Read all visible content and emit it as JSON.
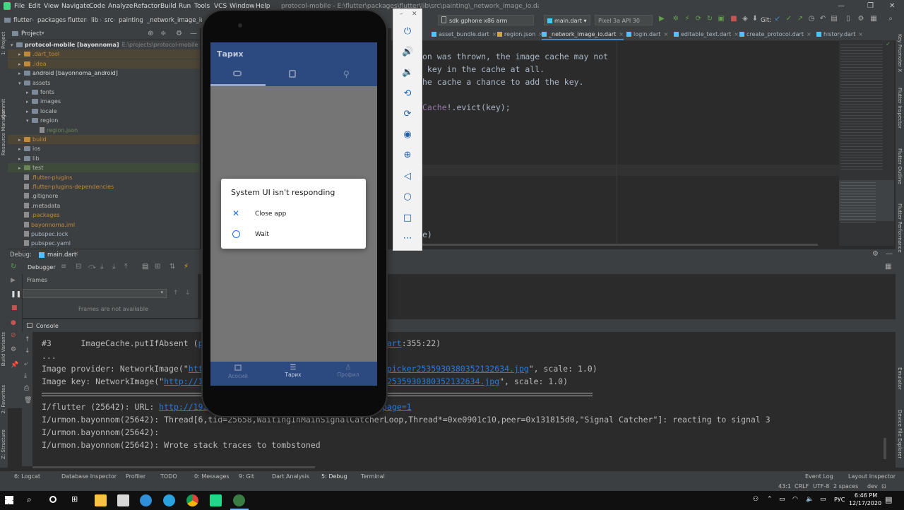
{
  "menubar": {
    "items": [
      "File",
      "Edit",
      "View",
      "Navigate",
      "Code",
      "Analyze",
      "Refactor",
      "Build",
      "Run",
      "Tools",
      "VCS",
      "Window",
      "Help"
    ],
    "title": "protocol-mobile - E:\\flutter\\packages\\flutter\\lib\\src\\painting\\_network_image_io.dart - Android Studio",
    "minimize": "—",
    "restore": "❐",
    "close": "✕"
  },
  "navbar": {
    "breadcrumbs": [
      "flutter",
      "packages",
      "flutter",
      "lib",
      "src",
      "painting",
      "_network_image_io"
    ],
    "device": "sdk gphone x86 arm (mobile)",
    "run_config": "main.dart",
    "avd": "Pixel 3a API 30",
    "git_label": "Git:"
  },
  "left_strip": [
    "1: Project",
    "Commit",
    "Resource Manager",
    "Build Variants",
    "2: Favorites",
    "Z: Structure"
  ],
  "right_strip": [
    "Key Promoter X",
    "Flutter Inspector",
    "Flutter Outline",
    "Flutter Performance",
    "Emulator",
    "Device File Explorer"
  ],
  "project": {
    "title": "Project",
    "tree": [
      {
        "label": "protocol-mobile [bayonnoma]",
        "suffix": "E:\\projects\\protocol-mobile",
        "indent": 0,
        "kind": "root",
        "open": true,
        "color": "#dcdcdc",
        "bg": ""
      },
      {
        "label": ".dart_tool",
        "indent": 1,
        "kind": "folder-orange",
        "open": false,
        "color": "#c08a3c",
        "bg": "#4d4536"
      },
      {
        "label": ".idea",
        "indent": 1,
        "kind": "folder-orange",
        "open": false,
        "color": "#c08a3c",
        "bg": "#4d4536"
      },
      {
        "label": "android [bayonnoma_android]",
        "indent": 1,
        "kind": "folder",
        "open": false,
        "color": "#dcdcdc",
        "bg": ""
      },
      {
        "label": "assets",
        "indent": 1,
        "kind": "folder",
        "open": true,
        "color": "#bbbbbb",
        "bg": ""
      },
      {
        "label": "fonts",
        "indent": 2,
        "kind": "folder",
        "open": false,
        "color": "#bbbbbb",
        "bg": ""
      },
      {
        "label": "images",
        "indent": 2,
        "kind": "folder",
        "open": false,
        "color": "#bbbbbb",
        "bg": ""
      },
      {
        "label": "locale",
        "indent": 2,
        "kind": "folder",
        "open": false,
        "color": "#bbbbbb",
        "bg": ""
      },
      {
        "label": "region",
        "indent": 2,
        "kind": "folder",
        "open": true,
        "color": "#bbbbbb",
        "bg": ""
      },
      {
        "label": "region.json",
        "indent": 3,
        "kind": "file",
        "open": null,
        "color": "#6a8759",
        "bg": ""
      },
      {
        "label": "build",
        "indent": 1,
        "kind": "folder-orange",
        "open": false,
        "color": "#c08a3c",
        "bg": "#4d4536"
      },
      {
        "label": "ios",
        "indent": 1,
        "kind": "folder",
        "open": false,
        "color": "#bbbbbb",
        "bg": ""
      },
      {
        "label": "lib",
        "indent": 1,
        "kind": "folder",
        "open": false,
        "color": "#bbbbbb",
        "bg": ""
      },
      {
        "label": "test",
        "indent": 1,
        "kind": "folder-green",
        "open": false,
        "color": "#bbbbbb",
        "bg": "#3f4b3a"
      },
      {
        "label": ".flutter-plugins",
        "indent": 1,
        "kind": "file",
        "open": null,
        "color": "#c08a3c",
        "bg": ""
      },
      {
        "label": ".flutter-plugins-dependencies",
        "indent": 1,
        "kind": "file",
        "open": null,
        "color": "#c08a3c",
        "bg": ""
      },
      {
        "label": ".gitignore",
        "indent": 1,
        "kind": "file",
        "open": null,
        "color": "#bbbbbb",
        "bg": ""
      },
      {
        "label": ".metadata",
        "indent": 1,
        "kind": "file",
        "open": null,
        "color": "#bbbbbb",
        "bg": ""
      },
      {
        "label": ".packages",
        "indent": 1,
        "kind": "file",
        "open": null,
        "color": "#c08a3c",
        "bg": ""
      },
      {
        "label": "bayonnoma.iml",
        "indent": 1,
        "kind": "file",
        "open": null,
        "color": "#c08a3c",
        "bg": ""
      },
      {
        "label": "pubspec.lock",
        "indent": 1,
        "kind": "file",
        "open": null,
        "color": "#a9b7c6",
        "bg": ""
      },
      {
        "label": "pubspec.yaml",
        "indent": 1,
        "kind": "file",
        "open": null,
        "color": "#a9b7c6",
        "bg": ""
      }
    ]
  },
  "editor_tabs": [
    {
      "label": "asset_bundle.dart",
      "active": false
    },
    {
      "label": "region.json",
      "active": false
    },
    {
      "label": "_network_image_io.dart",
      "active": true
    },
    {
      "label": "login.dart",
      "active": false
    },
    {
      "label": "editable_text.dart",
      "active": false
    },
    {
      "label": "create_protocol.dart",
      "active": false
    },
    {
      "label": "history.dart",
      "active": false
    }
  ],
  "editor_lines": [
    {
      "pre": "on was thrown, the image cache may not",
      "hl": "",
      "post": ""
    },
    {
      "pre": " key in the cache at all.",
      "hl": "",
      "post": ""
    },
    {
      "pre": "he cache a chance to add the key.",
      "hl": "",
      "post": ""
    },
    {
      "pre": "",
      "hl": "Cache",
      "post": "!.evict(key);"
    },
    {
      "pre": "e)",
      "hl": "",
      "post": ""
    }
  ],
  "debug": {
    "label": "Debug:",
    "tab": "main.dart",
    "debugger_tab": "Debugger",
    "frames_title": "Frames",
    "frames_empty": "Frames are not available",
    "console_tab": "Console"
  },
  "console": {
    "lines": [
      {
        "parts": [
          {
            "t": "#3      ImageCache.putIfAbsent (",
            "link": false
          },
          {
            "t": "pa",
            "link": true
          }
        ],
        "tail": [
          {
            "t": "dart",
            "link": true
          },
          {
            "t": ":355:22)",
            "link": false
          }
        ]
      },
      {
        "parts": [
          {
            "t": "...",
            "link": false
          }
        ],
        "tail": []
      },
      {
        "parts": [
          {
            "t": "Image provider: NetworkImage(\"",
            "link": false
          },
          {
            "t": "htt",
            "link": true
          }
        ],
        "tail": [
          {
            "t": "_picker2535930380352132634.jpg",
            "link": true
          },
          {
            "t": "\", scale: 1.0)",
            "link": false
          }
        ]
      },
      {
        "parts": [
          {
            "t": "Image key: NetworkImage(\"",
            "link": false
          },
          {
            "t": "http://19",
            "link": true
          }
        ],
        "tail": [
          {
            "t": "er2535930380352132634.jpg",
            "link": true
          },
          {
            "t": "\", scale: 1.0)",
            "link": false
          }
        ]
      },
      {
        "parts": [
          {
            "t": "I/flutter (25642): URL: ",
            "link": false
          },
          {
            "t": "http://192.",
            "link": true
          }
        ],
        "tail": [
          {
            "t": "page=1",
            "link": true
          }
        ]
      },
      {
        "parts": [
          {
            "t": "I/urmon.bayonnom(25642): Thread[6,tid=25658,WaitingInMainSignalCatcherLoop,Thread*=0xe0901c10,peer=0x131815d0,\"Signal Catcher\"]: reacting to signal 3",
            "link": false
          }
        ],
        "tail": []
      },
      {
        "parts": [
          {
            "t": "I/urmon.bayonnom(25642):",
            "link": false
          }
        ],
        "tail": []
      },
      {
        "parts": [
          {
            "t": "I/urmon.bayonnom(25642): Wrote stack traces to tombstoned",
            "link": false
          }
        ],
        "tail": []
      }
    ]
  },
  "bottom_tabs": [
    "6: Logcat",
    "Database Inspector",
    "Profiler",
    "TODO",
    "0: Messages",
    "9: Git",
    "Dart Analysis",
    "5: Debug",
    "Terminal",
    "Event Log",
    "Layout Inspector"
  ],
  "statusbar": {
    "position": "43:1",
    "line_sep": "CRLF",
    "encoding": "UTF-8",
    "indent": "2 spaces",
    "branch": "dev"
  },
  "phone": {
    "app_title": "Тарих",
    "bottom_nav": [
      "Асосий",
      "Тарих",
      "Профил"
    ],
    "dialog": {
      "title": "System UI isn't responding",
      "close_label": "Close app",
      "wait_label": "Wait"
    }
  },
  "taskbar": {
    "lang": "РУС",
    "time": "6:46 PM",
    "date": "12/17/2020"
  }
}
